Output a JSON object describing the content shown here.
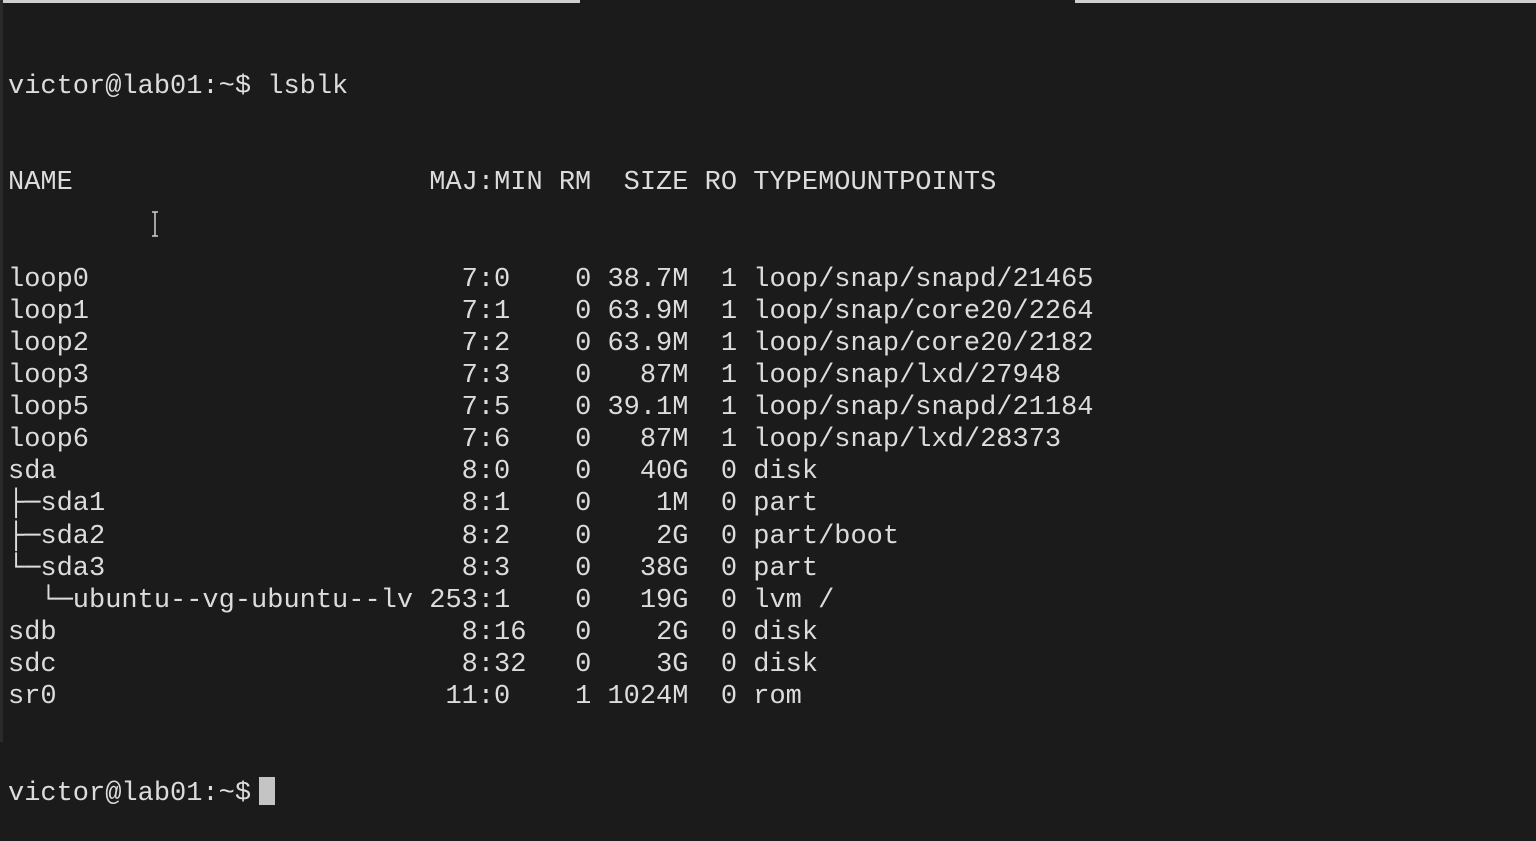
{
  "prompt": "victor@lab01:~$",
  "command": "lsblk",
  "headers": {
    "name": "NAME",
    "maj_min": "MAJ:MIN",
    "rm": "RM",
    "size": "SIZE",
    "ro": "RO",
    "type": "TYPE",
    "mountpoints": "MOUNTPOINTS"
  },
  "rows": [
    {
      "name": "loop0",
      "maj_min": "7:0",
      "rm": "0",
      "size": "38.7M",
      "ro": "1",
      "type": "loop",
      "mountpoints": "/snap/snapd/21465"
    },
    {
      "name": "loop1",
      "maj_min": "7:1",
      "rm": "0",
      "size": "63.9M",
      "ro": "1",
      "type": "loop",
      "mountpoints": "/snap/core20/2264"
    },
    {
      "name": "loop2",
      "maj_min": "7:2",
      "rm": "0",
      "size": "63.9M",
      "ro": "1",
      "type": "loop",
      "mountpoints": "/snap/core20/2182"
    },
    {
      "name": "loop3",
      "maj_min": "7:3",
      "rm": "0",
      "size": "87M",
      "ro": "1",
      "type": "loop",
      "mountpoints": "/snap/lxd/27948"
    },
    {
      "name": "loop5",
      "maj_min": "7:5",
      "rm": "0",
      "size": "39.1M",
      "ro": "1",
      "type": "loop",
      "mountpoints": "/snap/snapd/21184"
    },
    {
      "name": "loop6",
      "maj_min": "7:6",
      "rm": "0",
      "size": "87M",
      "ro": "1",
      "type": "loop",
      "mountpoints": "/snap/lxd/28373"
    },
    {
      "name": "sda",
      "maj_min": "8:0",
      "rm": "0",
      "size": "40G",
      "ro": "0",
      "type": "disk",
      "mountpoints": ""
    },
    {
      "name": "├─sda1",
      "maj_min": "8:1",
      "rm": "0",
      "size": "1M",
      "ro": "0",
      "type": "part",
      "mountpoints": ""
    },
    {
      "name": "├─sda2",
      "maj_min": "8:2",
      "rm": "0",
      "size": "2G",
      "ro": "0",
      "type": "part",
      "mountpoints": "/boot"
    },
    {
      "name": "└─sda3",
      "maj_min": "8:3",
      "rm": "0",
      "size": "38G",
      "ro": "0",
      "type": "part",
      "mountpoints": ""
    },
    {
      "name": "  └─ubuntu--vg-ubuntu--lv",
      "maj_min": "253:1",
      "rm": "0",
      "size": "19G",
      "ro": "0",
      "type": "lvm",
      "mountpoints": "/"
    },
    {
      "name": "sdb",
      "maj_min": "8:16",
      "rm": "0",
      "size": "2G",
      "ro": "0",
      "type": "disk",
      "mountpoints": ""
    },
    {
      "name": "sdc",
      "maj_min": "8:32",
      "rm": "0",
      "size": "3G",
      "ro": "0",
      "type": "disk",
      "mountpoints": ""
    },
    {
      "name": "sr0",
      "maj_min": "11:0",
      "rm": "1",
      "size": "1024M",
      "ro": "0",
      "type": "rom",
      "mountpoints": ""
    }
  ],
  "colors": {
    "background": "#1b1b1b",
    "text": "#dcdcdc",
    "cursor": "#c4c4c4"
  }
}
